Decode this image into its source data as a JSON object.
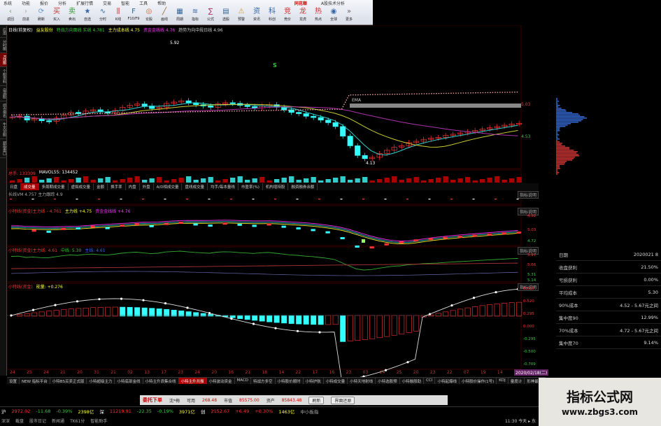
{
  "menu": [
    "系统",
    "功能",
    "报价",
    "分析",
    "扩展行情",
    "交易",
    "智能",
    "工具",
    "帮助"
  ],
  "app_logo": "同花顺",
  "app_subtitle": "A股技术分析",
  "toolbar": [
    {
      "label": "返回",
      "icon": "‹",
      "color": "#6a6"
    },
    {
      "label": "前进",
      "icon": "›",
      "color": "#aaa"
    },
    {
      "label": "刷新",
      "icon": "⟳",
      "color": "#69c"
    },
    {
      "label": "买入",
      "icon": "买",
      "color": "#c33"
    },
    {
      "label": "卖出",
      "icon": "卖",
      "color": "#393"
    },
    {
      "label": "自选",
      "icon": "★",
      "color": "#36a"
    },
    {
      "label": "分时",
      "icon": "∿",
      "color": "#369"
    },
    {
      "label": "K线",
      "icon": "⫼",
      "color": "#c33"
    },
    {
      "label": "F10/F9",
      "icon": "F",
      "color": "#369"
    },
    {
      "label": "论股",
      "icon": "◎",
      "color": "#c63"
    },
    {
      "label": "画线",
      "icon": "╱",
      "color": "#963"
    },
    {
      "label": "周期",
      "icon": "▦",
      "color": "#369"
    },
    {
      "label": "指标",
      "icon": "≋",
      "color": "#36a"
    },
    {
      "label": "公式",
      "icon": "∑",
      "color": "#a36"
    },
    {
      "label": "选股",
      "icon": "▤",
      "color": "#369"
    },
    {
      "label": "预警",
      "icon": "⚠",
      "color": "#c93"
    },
    {
      "label": "资讯",
      "icon": "资",
      "color": "#36a"
    },
    {
      "label": "科创",
      "icon": "科",
      "color": "#36a"
    },
    {
      "label": "竞价",
      "icon": "竞",
      "color": "#c33"
    },
    {
      "label": "龙虎",
      "icon": "龙",
      "color": "#c33"
    },
    {
      "label": "热点",
      "icon": "热",
      "color": "#c33"
    },
    {
      "label": "全球",
      "icon": "◉",
      "color": "#36a"
    },
    {
      "label": "更多",
      "icon": "»",
      "color": "#666"
    }
  ],
  "left_tabs": [
    {
      "label": "应用"
    },
    {
      "label": "分时图"
    },
    {
      "label": "K线图",
      "active": true
    },
    {
      "label": "个股资料"
    },
    {
      "label": "自选股"
    },
    {
      "label": "综合排名"
    },
    {
      "label": "牛叉诊股"
    },
    {
      "label": "超级盘口"
    }
  ],
  "main_header": {
    "period": "日线(前复权)",
    "name": "益友股份",
    "items": [
      {
        "text": "特战方向面线  实线 4.781",
        "color": "#3c3"
      },
      {
        "text": "主力成本线  4.75",
        "color": "#ff3"
      },
      {
        "text": "资金金线线  4.76",
        "color": "#f3f"
      },
      {
        "text": "趋势为向中段日线  4.96",
        "color": "#ccc"
      }
    ]
  },
  "price_axis": [
    "5.03",
    "4.53"
  ],
  "price_labels": {
    "high": "5.92",
    "low": "4.13",
    "cma": "EMA"
  },
  "volume_header": {
    "label": "总手: 133309",
    "ma": "MAVOL55: 134452"
  },
  "ind_tabs": [
    "日盘",
    "成交量",
    "多周期成交量",
    "虚拟成交量",
    "金额",
    "换手率",
    "内盘",
    "外盘",
    "A/D相成交量",
    "盘线成交量",
    "均手/每本量线",
    "市盈率(%)",
    "机构增持股",
    "融资融券余额"
  ],
  "ind_tab_active": 1,
  "ind2_header": "长线VM  4.757  主力跟踪  4.9",
  "ind3_header": [
    {
      "text": "小特线(资金)主力线 - 4.761",
      "color": "#f33"
    },
    {
      "text": "主力线  +4.75",
      "color": "#ff3"
    },
    {
      "text": "资金金线线  +4.76",
      "color": "#f3f"
    }
  ],
  "ind3_axis": [
    "4.92",
    "5.03",
    "4.72"
  ],
  "ind4_header": [
    {
      "text": "小特线(资金)主力线: 4.61",
      "color": "#f33"
    },
    {
      "text": "中线: 5.30",
      "color": "#3c3"
    },
    {
      "text": "主线: 4.61",
      "color": "#36f"
    }
  ],
  "ind4_axis": [
    "5.97",
    "5.66",
    "5.31",
    "5.14"
  ],
  "ind5_header": [
    {
      "text": "小特线(资金)",
      "color": "#f33"
    },
    {
      "text": "能量: +0.276",
      "color": "#ff3"
    }
  ],
  "ind5_axis": [
    "0.626",
    "0.520",
    "0.295",
    "0.000",
    "-0.295",
    "-0.500",
    "-0.709"
  ],
  "x_dates": [
    "24",
    "25",
    "24",
    "21",
    "20",
    "31",
    "21",
    "02",
    "13",
    "17",
    "23",
    "24",
    "20",
    "16",
    "21",
    "18",
    "14",
    "22",
    "17",
    "16",
    "23",
    "03",
    "24",
    "25",
    "20",
    "23",
    "22",
    "07",
    "19",
    "14",
    "17"
  ],
  "x_end_date": "2020/02/18(二)",
  "bottom_tabs": [
    "设置",
    "NEW 指标平台",
    "小特BS买卖正式版",
    "小特超级主力",
    "小特底部金线",
    "小特主升浪集合线",
    "小特主升共振",
    "小特波动资金",
    "MACD",
    "特战方多空",
    "小特股价顺时",
    "小特护航",
    "小特成交量",
    "小特天地射线",
    "小特选股预",
    "小特融股助",
    "CCI",
    "小特起爆线",
    "小特股价操作(1号)",
    "KDJ",
    "量度计",
    "形神最佳"
  ],
  "bottom_tab_active": 6,
  "trade_bar": {
    "title": "委托下单",
    "code": "沈*梅",
    "avail_label": "可用",
    "avail": "268.48",
    "market_label": "市值",
    "market": "85575.00",
    "assets_label": "资产",
    "assets": "85843.48",
    "refresh": "刷新",
    "clean": "界面还原"
  },
  "ticker": [
    {
      "name": "沪",
      "val": "2972.02",
      "color": "#f33"
    },
    {
      "name": "",
      "val": "-11.68",
      "color": "#3c3"
    },
    {
      "name": "",
      "val": "-0.39%",
      "color": "#3c3"
    },
    {
      "name": "",
      "val": "2398亿",
      "color": "#ff3"
    },
    {
      "name": "深",
      "val": "11219.91",
      "color": "#f33"
    },
    {
      "name": "",
      "val": "-22.35",
      "color": "#3c3"
    },
    {
      "name": "",
      "val": "-0.19%",
      "color": "#3c3"
    },
    {
      "name": "",
      "val": "3971亿",
      "color": "#ff3"
    },
    {
      "name": "创",
      "val": "2152.67",
      "color": "#f33"
    },
    {
      "name": "",
      "val": "+6.49",
      "color": "#f33"
    },
    {
      "name": "",
      "val": "+0.30%",
      "color": "#f33"
    },
    {
      "name": "",
      "val": "1463亿",
      "color": "#ff3"
    },
    {
      "name": "",
      "val": "中小板指",
      "color": "#aaa"
    }
  ],
  "status_items": [
    "深深",
    "截盘",
    "股市日记",
    "新闻通",
    "TK61分",
    "智能助手"
  ],
  "status_time": "11:30 今天 ▸ 东",
  "side_panel": [
    {
      "label": "日期",
      "value": "2020021 8"
    },
    {
      "label": "收盘获利",
      "value": "21.50%"
    },
    {
      "label": "亏损获利",
      "value": "0.00%"
    },
    {
      "label": "平均成本",
      "value": "5.30"
    },
    {
      "label": "90%成本",
      "value": "4.52 - 5.67元之间"
    },
    {
      "label": "集中度90",
      "value": "12.99%"
    },
    {
      "label": "70%成本",
      "value": "4.72 - 5.67元之间"
    },
    {
      "label": "集中度70",
      "value": "9.14%"
    }
  ],
  "watermark": {
    "title": "指标公式网",
    "url": "www.zbgs3.com"
  },
  "explain_label": "指标说明",
  "colors": {
    "up": "#ff3333",
    "down": "#33ffff",
    "ma_cyan": "#33cccc",
    "ma_yellow": "#cccc33",
    "ma_purple": "#aa33aa"
  }
}
